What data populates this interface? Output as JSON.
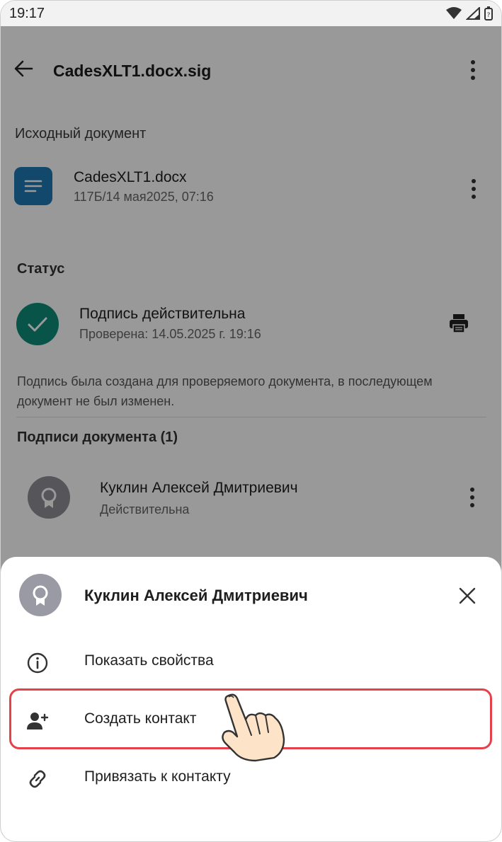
{
  "status_bar": {
    "time": "19:17"
  },
  "header": {
    "title": "CadesXLT1.docx.sig"
  },
  "source_document": {
    "section_label": "Исходный документ",
    "file_name": "CadesXLT1.docx",
    "file_meta": "117Б/14 мая2025, 07:16"
  },
  "status": {
    "section_label": "Статус",
    "title": "Подпись действительна",
    "checked": "Проверена: 14.05.2025 г. 19:16",
    "description": "Подпись была создана для проверяемого документа, в последующем документ не был изменен."
  },
  "signatures": {
    "section_label": "Подписи документа (1)",
    "items": [
      {
        "name": "Куклин Алексей Дмитриевич",
        "state": "Действительна"
      }
    ]
  },
  "bottom_sheet": {
    "title": "Куклин Алексей Дмитриевич",
    "actions": [
      {
        "label": "Показать свойства",
        "icon": "info-icon"
      },
      {
        "label": "Создать контакт",
        "icon": "add-person-icon"
      },
      {
        "label": "Привязать к контакту",
        "icon": "link-icon"
      }
    ]
  },
  "colors": {
    "accent_doc": "#1f78b4",
    "status_ok": "#0e8c7b",
    "highlight": "#e5414b"
  }
}
